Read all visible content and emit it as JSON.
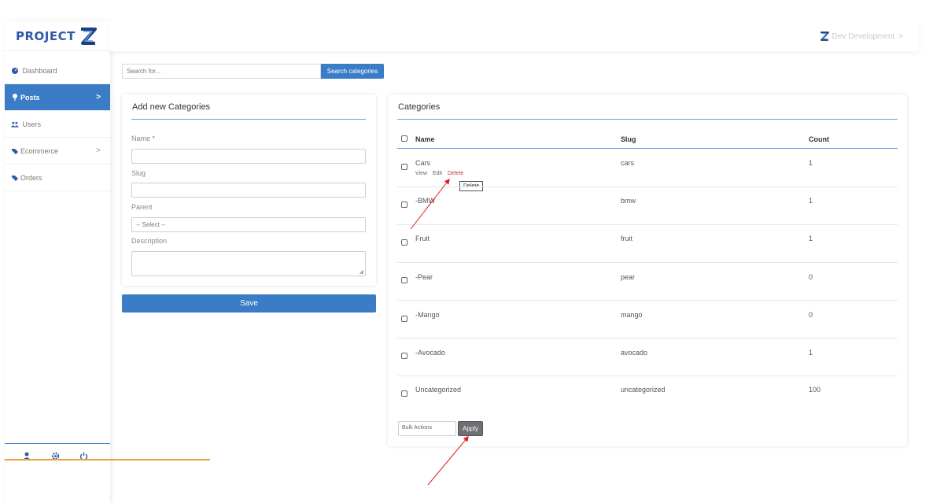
{
  "app": {
    "logo_text": "PROJECT",
    "user_name": "Dev Development"
  },
  "sidebar": {
    "items": [
      {
        "label": "Dashboard",
        "icon": "dashboard-icon"
      },
      {
        "label": "Posts",
        "icon": "pin-icon",
        "active": true
      },
      {
        "label": "Users",
        "icon": "users-icon"
      },
      {
        "label": "Ecommerce",
        "icon": "tag-icon"
      },
      {
        "label": "Orders",
        "icon": "tag-icon"
      }
    ],
    "footer_icons": [
      "user-icon",
      "gear-icon",
      "power-icon"
    ]
  },
  "search": {
    "placeholder": "Search for...",
    "button_label": "Search categories"
  },
  "add_form": {
    "title": "Add new Categories",
    "name_label": "Name",
    "required_mark": "*",
    "slug_label": "Slug",
    "parent_label": "Parent",
    "parent_value": "-- Select --",
    "description_label": "Description",
    "save_label": "Save"
  },
  "categories": {
    "title": "Categories",
    "columns": [
      "Name",
      "Slug",
      "Count"
    ],
    "rows": [
      {
        "name": "Cars",
        "slug": "cars",
        "count": "1"
      },
      {
        "name": "-BMW",
        "slug": "bmw",
        "count": "1"
      },
      {
        "name": "Fruit",
        "slug": "fruit",
        "count": "1"
      },
      {
        "name": "-Pear",
        "slug": "pear",
        "count": "0"
      },
      {
        "name": "-Mango",
        "slug": "mango",
        "count": "0"
      },
      {
        "name": "-Avocado",
        "slug": "avocado",
        "count": "1"
      },
      {
        "name": "Uncategorized",
        "slug": "uncategorized",
        "count": "100"
      }
    ],
    "row_actions": {
      "view": "View",
      "edit": "Edit",
      "delete": "Delete"
    },
    "tooltip": "Delete",
    "bulk_actions": "Bulk Actions",
    "apply_label": "Apply"
  },
  "colors": {
    "accent": "#3b7cc6",
    "delete": "#c0392b",
    "annotation_arrow": "#e02020"
  }
}
